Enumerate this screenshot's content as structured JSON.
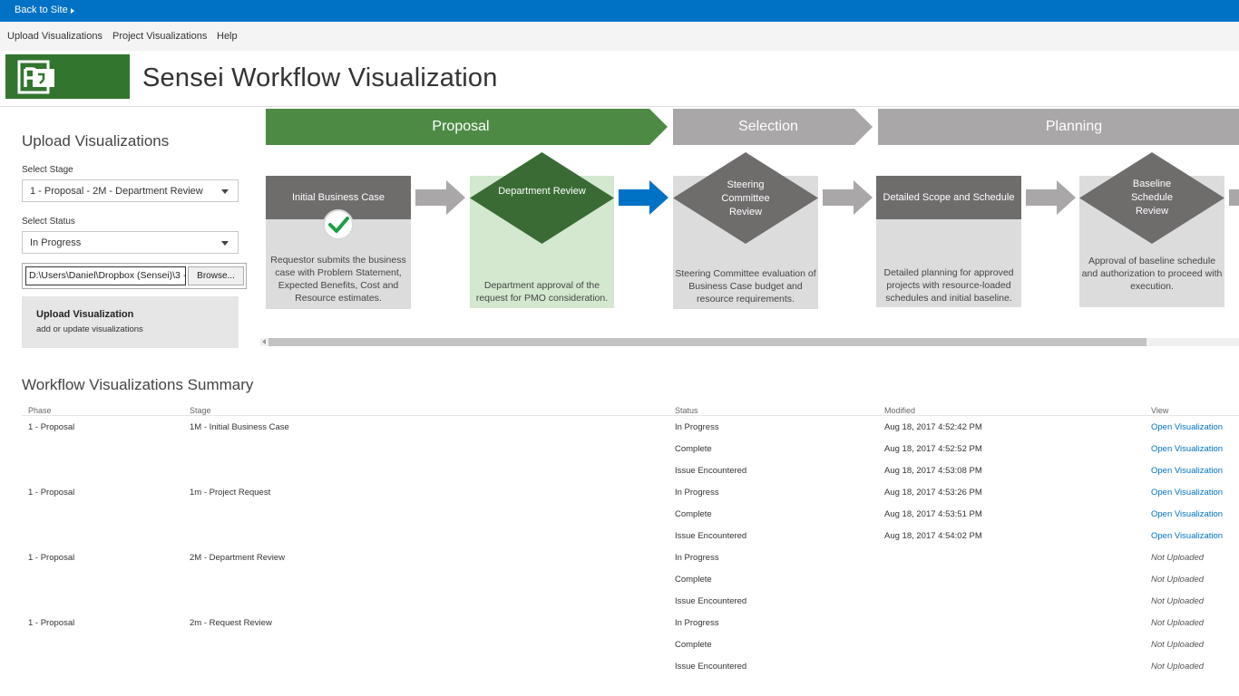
{
  "topbar": {
    "back_label": "Back to Site"
  },
  "nav": {
    "items": [
      "Upload Visualizations",
      "Project Visualizations",
      "Help"
    ]
  },
  "header": {
    "title": "Sensei Workflow Visualization",
    "logo_letter": "P"
  },
  "panel": {
    "title": "Upload Visualizations",
    "stage_label": "Select Stage",
    "stage_value": "1 - Proposal - 2M - Department Review",
    "status_label": "Select Status",
    "status_value": "In Progress",
    "file_value": "D:\\Users\\Daniel\\Dropbox (Sensei)\\3 - ",
    "browse_label": "Browse...",
    "upload_title": "Upload Visualization",
    "upload_sub": "add or update visualizations"
  },
  "workflow": {
    "phases": [
      "Proposal",
      "Selection",
      "Planning"
    ],
    "steps": [
      {
        "type": "card",
        "title": "Initial Business Case",
        "desc": "Requestor submits the business case with Problem Statement, Expected Benefits, Cost and Resource estimates.",
        "check": true
      },
      {
        "type": "diamond",
        "title": "Department Review",
        "desc": "Department approval of the request for PMO consideration.",
        "highlight": true
      },
      {
        "type": "diamond",
        "title": "Steering Committee Review",
        "desc": "Steering Committee evaluation of Business Case budget and resource requirements."
      },
      {
        "type": "card",
        "title": "Detailed Scope and Schedule",
        "desc": "Detailed planning for approved projects with resource-loaded schedules and initial baseline."
      },
      {
        "type": "diamond",
        "title": "Baseline Schedule Review",
        "desc": "Approval of baseline schedule and authorization to proceed with execution."
      }
    ],
    "colors": {
      "proposal": "#4d8b45",
      "phase_gray": "#a9a7a7",
      "dark_green": "#3a6b35",
      "highlight_bg": "#d3e8cf",
      "card_head": "#6f6c6c",
      "arrow_gray": "#a9a7a7",
      "arrow_blue": "#0072c6"
    }
  },
  "summary": {
    "title": "Workflow Visualizations Summary",
    "headers": {
      "phase": "Phase",
      "stage": "Stage",
      "status": "Status",
      "modified": "Modified",
      "view": "View"
    },
    "rows": [
      {
        "phase": "1 - Proposal",
        "stage": "1M - Initial Business Case",
        "status": "In Progress",
        "modified": "Aug 18, 2017 4:52:42 PM",
        "view": "Open Visualization"
      },
      {
        "phase": "",
        "stage": "",
        "status": "Complete",
        "modified": "Aug 18, 2017 4:52:52 PM",
        "view": "Open Visualization"
      },
      {
        "phase": "",
        "stage": "",
        "status": "Issue Encountered",
        "modified": "Aug 18, 2017 4:53:08 PM",
        "view": "Open Visualization"
      },
      {
        "phase": "1 - Proposal",
        "stage": "1m - Project Request",
        "status": "In Progress",
        "modified": "Aug 18, 2017 4:53:26 PM",
        "view": "Open Visualization"
      },
      {
        "phase": "",
        "stage": "",
        "status": "Complete",
        "modified": "Aug 18, 2017 4:53:51 PM",
        "view": "Open Visualization"
      },
      {
        "phase": "",
        "stage": "",
        "status": "Issue Encountered",
        "modified": "Aug 18, 2017 4:54:02 PM",
        "view": "Open Visualization"
      },
      {
        "phase": "1 - Proposal",
        "stage": "2M - Department Review",
        "status": "In Progress",
        "modified": "",
        "view": "Not Uploaded"
      },
      {
        "phase": "",
        "stage": "",
        "status": "Complete",
        "modified": "",
        "view": "Not Uploaded"
      },
      {
        "phase": "",
        "stage": "",
        "status": "Issue Encountered",
        "modified": "",
        "view": "Not Uploaded"
      },
      {
        "phase": "1 - Proposal",
        "stage": "2m - Request Review",
        "status": "In Progress",
        "modified": "",
        "view": "Not Uploaded"
      },
      {
        "phase": "",
        "stage": "",
        "status": "Complete",
        "modified": "",
        "view": "Not Uploaded"
      },
      {
        "phase": "",
        "stage": "",
        "status": "Issue Encountered",
        "modified": "",
        "view": "Not Uploaded"
      }
    ]
  }
}
